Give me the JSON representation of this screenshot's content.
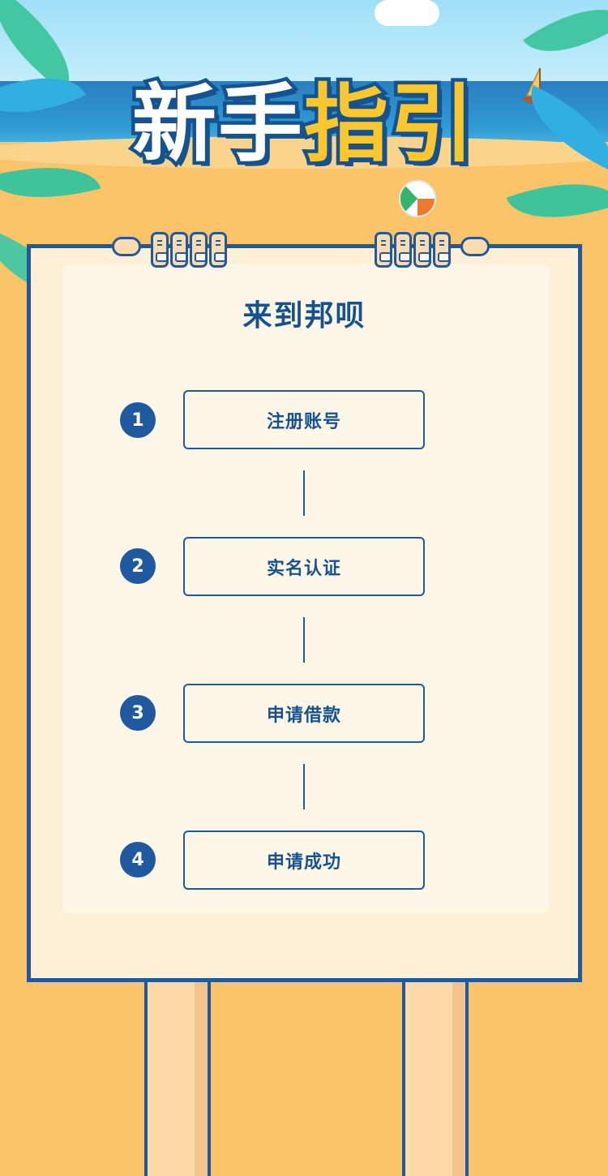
{
  "banner": {
    "title_part1": "新手",
    "title_part2": "指引"
  },
  "sign": {
    "heading": "来到邦呗"
  },
  "steps": [
    {
      "number": "1",
      "label": "注册账号"
    },
    {
      "number": "2",
      "label": "实名认证"
    },
    {
      "number": "3",
      "label": "申请借款"
    },
    {
      "number": "4",
      "label": "申请成功"
    }
  ],
  "colors": {
    "primary_blue": "#1f5aa0",
    "sand": "#fcc468",
    "board_bg": "#fdf0d6",
    "title_yellow": "#fcc62d"
  }
}
